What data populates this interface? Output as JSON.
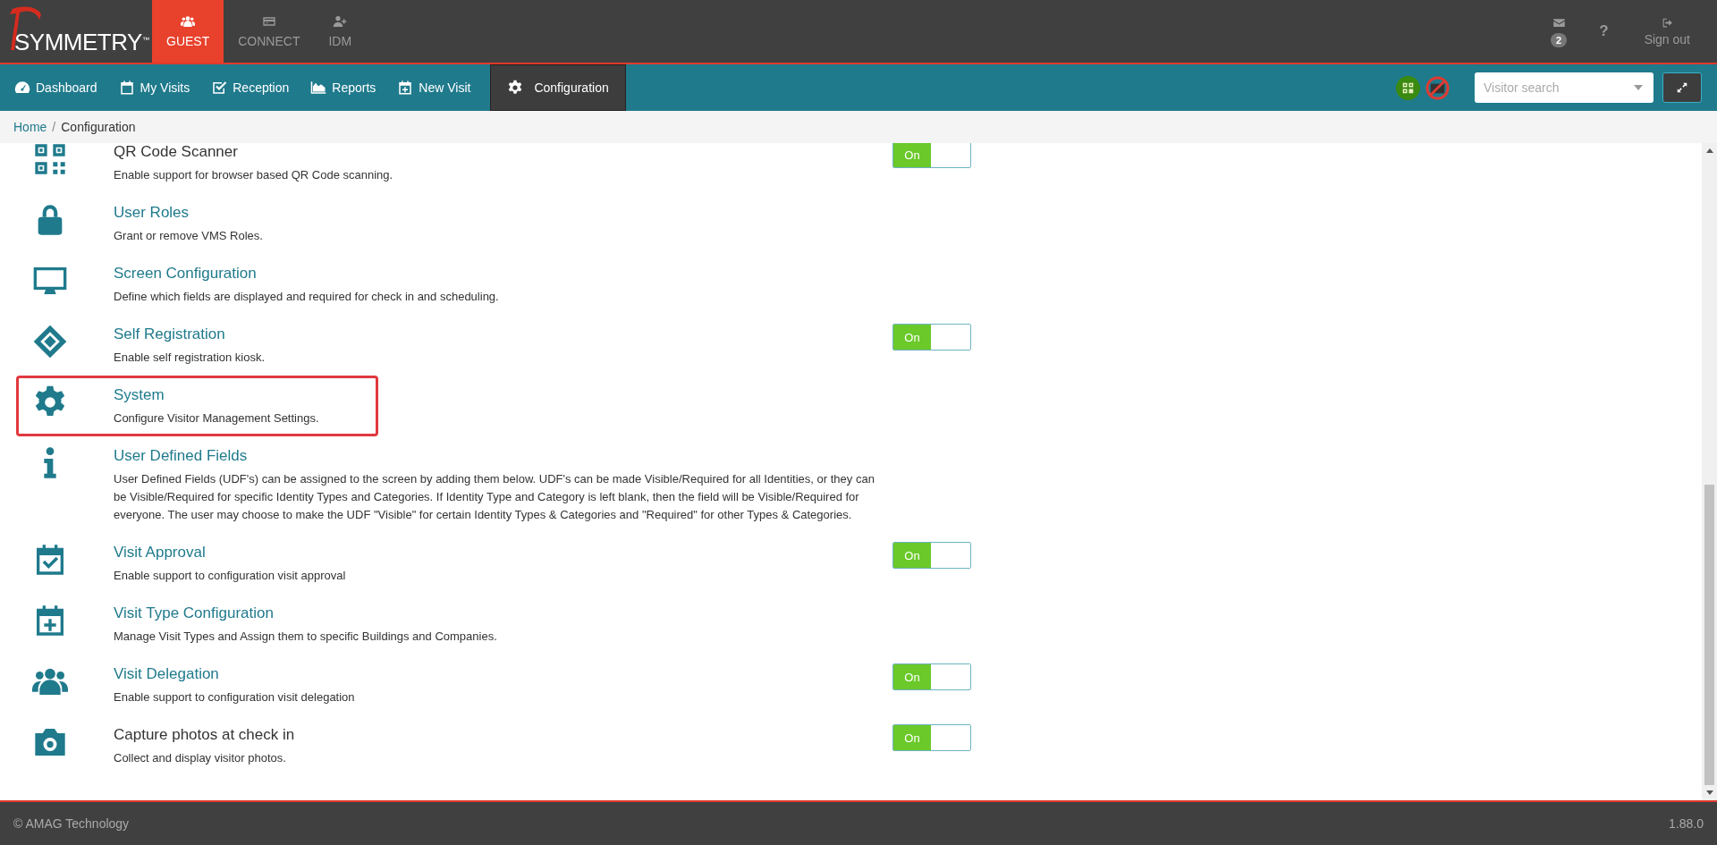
{
  "logo": {
    "text": "SYMMETRY",
    "mark": "™"
  },
  "modules": [
    {
      "label": "GUEST",
      "selected": true
    },
    {
      "label": "CONNECT",
      "selected": false
    },
    {
      "label": "IDM",
      "selected": false
    }
  ],
  "header_actions": {
    "messages_count": "2",
    "help": "?",
    "sign_out": "Sign out"
  },
  "nav_tabs": [
    {
      "label": "Dashboard",
      "selected": false
    },
    {
      "label": "My Visits",
      "selected": false
    },
    {
      "label": "Reception",
      "selected": false
    },
    {
      "label": "Reports",
      "selected": false
    },
    {
      "label": "New Visit",
      "selected": false
    },
    {
      "label": "Configuration",
      "selected": true
    }
  ],
  "visitor_search": {
    "placeholder": "Visitor search"
  },
  "breadcrumb": {
    "separator": "/",
    "items": [
      "Home",
      "Configuration"
    ]
  },
  "settings": [
    {
      "title": "QR Code Scanner",
      "link": false,
      "description": "Enable support for browser based QR Code scanning.",
      "highlighted": false,
      "toggle": {
        "label": "On",
        "on": true
      }
    },
    {
      "title": "User Roles",
      "link": true,
      "description": "Grant or remove VMS Roles.",
      "highlighted": false
    },
    {
      "title": "Screen Configuration",
      "link": true,
      "description": "Define which fields are displayed and required for check in and scheduling.",
      "highlighted": false
    },
    {
      "title": "Self Registration",
      "link": true,
      "description": "Enable self registration kiosk.",
      "highlighted": false,
      "toggle": {
        "label": "On",
        "on": true
      }
    },
    {
      "title": "System",
      "link": true,
      "description": "Configure Visitor Management Settings.",
      "highlighted": true
    },
    {
      "title": "User Defined Fields",
      "link": true,
      "description": "User Defined Fields (UDF's) can be assigned to the screen by adding them below. UDF's can be made Visible/Required for all Identities, or they can be Visible/Required for specific Identity Types and Categories. If Identity Type and Category is left blank, then the field will be Visible/Required for everyone. The user may choose to make the UDF \"Visible\" for certain Identity Types & Categories and \"Required\" for other Types & Categories.",
      "highlighted": false
    },
    {
      "title": "Visit Approval",
      "link": true,
      "description": "Enable support to configuration visit approval",
      "highlighted": false,
      "toggle": {
        "label": "On",
        "on": true
      }
    },
    {
      "title": "Visit Type Configuration",
      "link": true,
      "description": "Manage Visit Types and Assign them to specific Buildings and Companies.",
      "highlighted": false
    },
    {
      "title": "Visit Delegation",
      "link": true,
      "description": "Enable support to configuration visit delegation",
      "highlighted": false,
      "toggle": {
        "label": "On",
        "on": true
      }
    },
    {
      "title": "Capture photos at check in",
      "link": false,
      "description": "Collect and display visitor photos.",
      "highlighted": false,
      "toggle": {
        "label": "On",
        "on": true
      }
    }
  ],
  "footer": {
    "copyright": "© AMAG Technology",
    "version": "1.88.0"
  }
}
